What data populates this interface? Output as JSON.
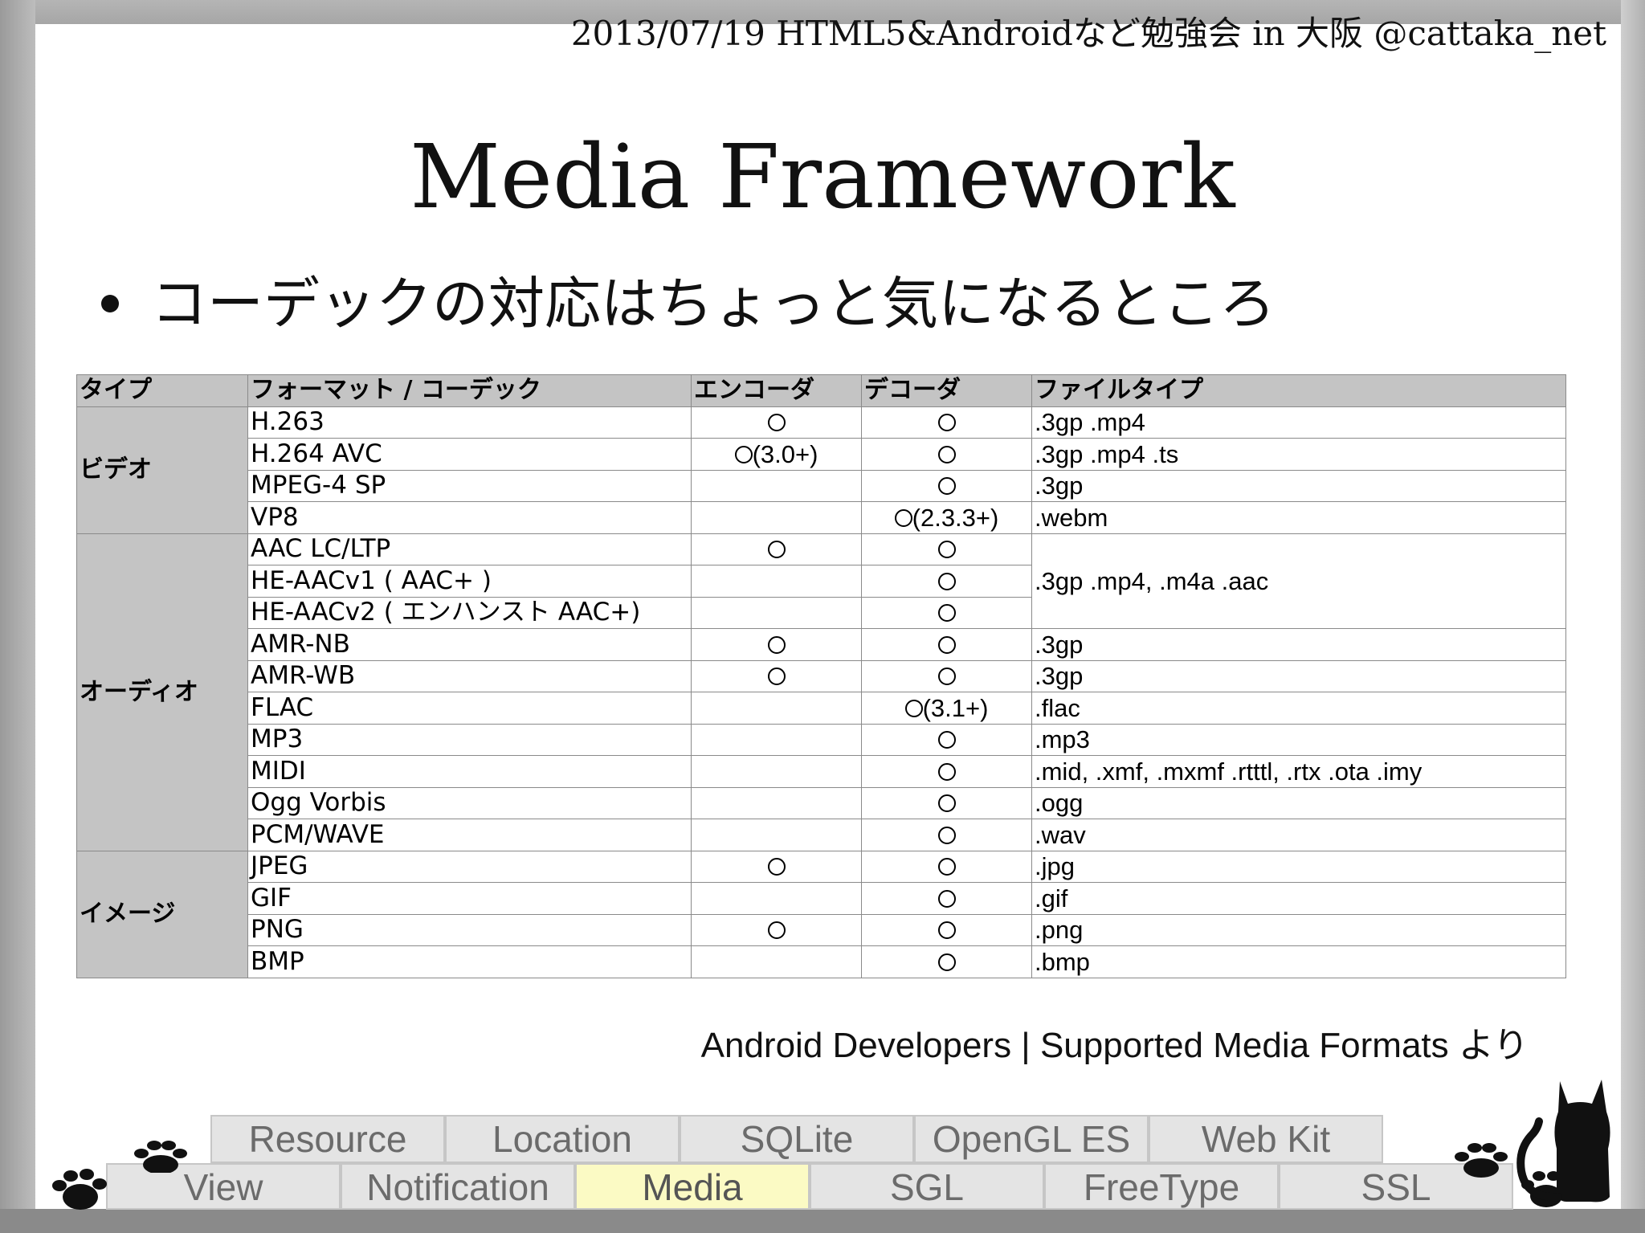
{
  "header": {
    "event_line": "2013/07/19 HTML5&Androidなど勉強会  in 大阪  @cattaka_net"
  },
  "slide": {
    "title": "Media Framework",
    "bullet": "コーデックの対応はちょっと気になるところ",
    "source_note": "Android Developers | Supported Media Formats より"
  },
  "table": {
    "headers": [
      "タイプ",
      "フォーマット / コーデック",
      "エンコーダ",
      "デコーダ",
      "ファイルタイプ"
    ],
    "groups": {
      "video": "ビデオ",
      "audio": "オーディオ",
      "image": "イメージ"
    },
    "rows": [
      {
        "format": "H.263",
        "encoder": "○",
        "decoder": "○",
        "filetype": ".3gp .mp4"
      },
      {
        "format": "H.264 AVC",
        "encoder": "○(3.0+)",
        "decoder": "○",
        "filetype": ".3gp .mp4 .ts"
      },
      {
        "format": "MPEG-4 SP",
        "encoder": "",
        "decoder": "○",
        "filetype": ".3gp"
      },
      {
        "format": "VP8",
        "encoder": "",
        "decoder": "○(2.3.3+)",
        "filetype": ".webm"
      },
      {
        "format": "AAC LC/LTP",
        "encoder": "○",
        "decoder": "○",
        "filetype": ".3gp .mp4, .m4a .aac"
      },
      {
        "format": "HE-AACv1 ( AAC+ )",
        "encoder": "",
        "decoder": "○",
        "filetype": ""
      },
      {
        "format": "HE-AACv2 ( エンハンスト AAC+)",
        "encoder": "",
        "decoder": "○",
        "filetype": ""
      },
      {
        "format": "AMR-NB",
        "encoder": "○",
        "decoder": "○",
        "filetype": ".3gp"
      },
      {
        "format": "AMR-WB",
        "encoder": "○",
        "decoder": "○",
        "filetype": ".3gp"
      },
      {
        "format": "FLAC",
        "encoder": "",
        "decoder": "○(3.1+)",
        "filetype": ".flac"
      },
      {
        "format": "MP3",
        "encoder": "",
        "decoder": "○",
        "filetype": ".mp3"
      },
      {
        "format": "MIDI",
        "encoder": "",
        "decoder": "○",
        "filetype": ".mid, .xmf, .mxmf .rtttl, .rtx .ota .imy"
      },
      {
        "format": "Ogg Vorbis",
        "encoder": "",
        "decoder": "○",
        "filetype": ".ogg"
      },
      {
        "format": "PCM/WAVE",
        "encoder": "",
        "decoder": "○",
        "filetype": ".wav"
      },
      {
        "format": "JPEG",
        "encoder": "○",
        "decoder": "○",
        "filetype": ".jpg"
      },
      {
        "format": "GIF",
        "encoder": "",
        "decoder": "○",
        "filetype": ".gif"
      },
      {
        "format": "PNG",
        "encoder": "○",
        "decoder": "○",
        "filetype": ".png"
      },
      {
        "format": "BMP",
        "encoder": "",
        "decoder": "○",
        "filetype": ".bmp"
      }
    ]
  },
  "nav": {
    "upper_tabs": [
      "Resource",
      "Location",
      "SQLite",
      "OpenGL ES",
      "Web Kit"
    ],
    "lower_tabs": [
      "View",
      "Notification",
      "Media",
      "SGL",
      "FreeType",
      "SSL"
    ],
    "active_tab": "Media"
  },
  "colors": {
    "active_tab": "#fbfac4",
    "tab": "#e4e4e4",
    "table_header": "#c4c4c4"
  },
  "icons": [
    "paw-print-icon",
    "cat-silhouette-icon"
  ]
}
